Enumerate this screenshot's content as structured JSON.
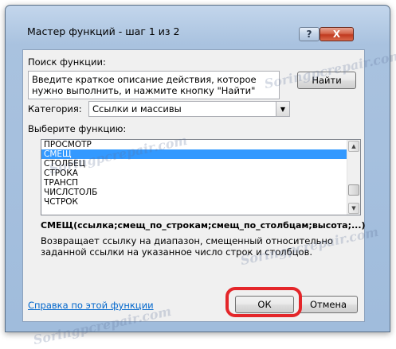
{
  "window": {
    "title": "Мастер функций - шаг 1 из 2",
    "help_glyph": "?",
    "close_glyph": "X"
  },
  "search": {
    "label": "Поиск функции:",
    "text": "Введите краткое описание действия, которое нужно выполнить, и нажмите кнопку \"Найти\"",
    "find_button": "Найти"
  },
  "category": {
    "label": "Категория:",
    "value": "Ссылки и массивы"
  },
  "function_list": {
    "label": "Выберите функцию:",
    "items": [
      "ПРОСМОТР",
      "СМЕЩ",
      "СТОЛБЕЦ",
      "СТРОКА",
      "ТРАНСП",
      "ЧИСЛСТОЛБ",
      "ЧСТРОК"
    ],
    "selected": "СМЕЩ"
  },
  "details": {
    "signature": "СМЕЩ(ссылка;смещ_по_строкам;смещ_по_столбцам;высота;...)",
    "description": "Возвращает ссылку на диапазон, смещенный относительно заданной ссылки на указанное число строк и столбцов."
  },
  "footer": {
    "help_link": "Справка по этой функции",
    "ok_button": "ОК",
    "cancel_button": "Отмена"
  },
  "watermark": "Soringpcrepair.com",
  "colors": {
    "selection": "#3399ff",
    "highlight": "#e4262a",
    "link": "#0066cc"
  }
}
